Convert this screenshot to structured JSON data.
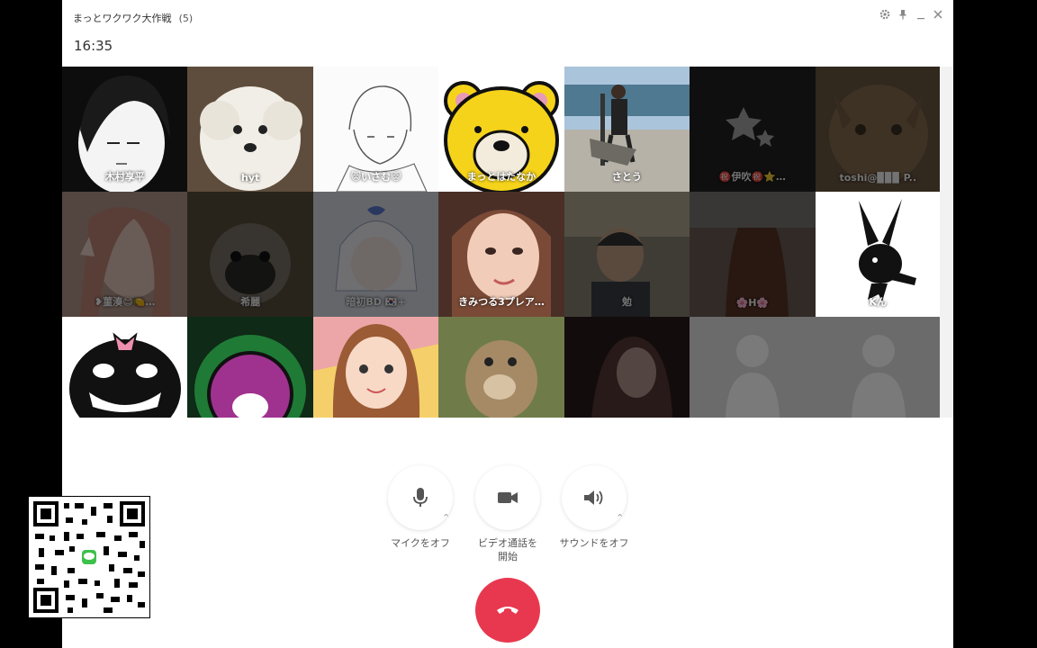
{
  "window": {
    "title": "まっとワクワク大作戦",
    "member_count": "(5)",
    "time": "16:35"
  },
  "colors": {
    "hangup": "#e8384f",
    "window_bg": "#ffffff",
    "screen_bg": "#000000"
  },
  "window_controls": [
    {
      "icon": "gear-icon"
    },
    {
      "icon": "pin-icon"
    },
    {
      "icon": "minimize-icon"
    },
    {
      "icon": "close-icon"
    }
  ],
  "participants": [
    {
      "name": "木村享平",
      "active": true
    },
    {
      "name": "hyt",
      "active": true
    },
    {
      "name": "😺いさむ😺",
      "active": true
    },
    {
      "name": "まっとはたなか",
      "active": true
    },
    {
      "name": "さとう",
      "active": true
    },
    {
      "name": "㊗️伊吹㊗️⭐…",
      "active": false
    },
    {
      "name": "toshi@▉▉▉ P..",
      "active": false
    },
    {
      "name": "❥菫湊😊🍋…",
      "active": false
    },
    {
      "name": "希麗",
      "active": false
    },
    {
      "name": "暗初BD 🇰🇷+",
      "active": false
    },
    {
      "name": "きみつる3プレア…",
      "active": false
    },
    {
      "name": "勉",
      "active": false
    },
    {
      "name": "🌸H🌸",
      "active": false
    },
    {
      "name": "Kん",
      "active": false
    },
    {
      "name": "",
      "active": false
    },
    {
      "name": "",
      "active": false
    },
    {
      "name": "",
      "active": false
    },
    {
      "name": "",
      "active": false
    },
    {
      "name": "",
      "active": false
    },
    {
      "name": "",
      "active": false
    }
  ],
  "controls": {
    "mic_label": "マイクをオフ",
    "video_label_line1": "ビデオ通話を",
    "video_label_line2": "開始",
    "sound_label": "サウンドをオフ"
  },
  "hangup_icon": "phone-hangup-icon",
  "qr_icon": "qr-code-icon"
}
